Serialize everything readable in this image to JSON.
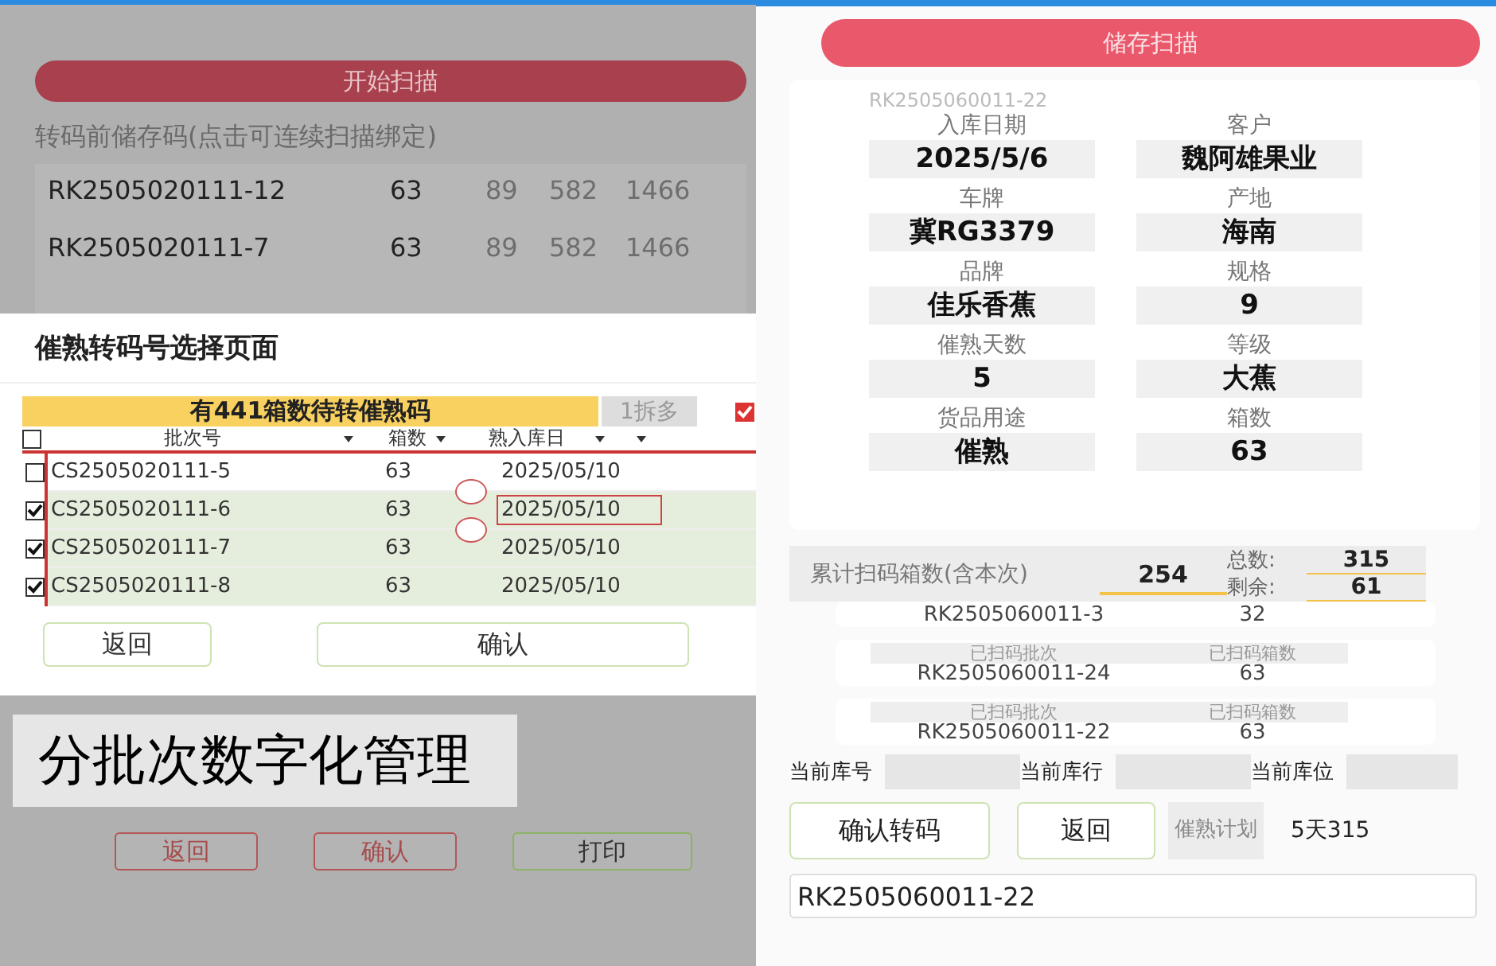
{
  "left_screen": {
    "background_page": {
      "scan_button": "开始扫描",
      "section_label": "转码前储存码(点击可连续扫描绑定)",
      "rows": [
        {
          "code": "RK2505020111-12",
          "boxes": "63",
          "column_3": "89",
          "column_4": "582",
          "column_5": "1466"
        },
        {
          "code": "RK2505020111-7",
          "boxes": "63",
          "column_3": "89",
          "column_4": "582",
          "column_5": "1466"
        }
      ],
      "buttons": [
        {
          "label": "返回",
          "kind": "danger"
        },
        {
          "label": "确认",
          "kind": "danger"
        },
        {
          "label": "打印",
          "kind": "ok"
        }
      ]
    },
    "dialog": {
      "title": "催熟转码号选择页面",
      "banner": "有441箱数待转催熟码",
      "split_button": "1拆多",
      "banner_checkbox": {
        "checked": true
      },
      "select_all": {
        "checked": false
      },
      "columns": [
        "批次号",
        "箱数",
        "熟入库日"
      ],
      "rows": [
        {
          "batch": "CS2505020111-5",
          "boxes": "63",
          "date": "2025/05/10",
          "checked": false,
          "selected": false,
          "editing": false
        },
        {
          "batch": "CS2505020111-6",
          "boxes": "63",
          "date": "2025/05/10",
          "checked": true,
          "selected": true,
          "editing": true
        },
        {
          "batch": "CS2505020111-7",
          "boxes": "63",
          "date": "2025/05/10",
          "checked": true,
          "selected": true,
          "editing": false
        },
        {
          "batch": "CS2505020111-8",
          "boxes": "63",
          "date": "2025/05/10",
          "checked": true,
          "selected": true,
          "editing": false
        }
      ],
      "buttons": [
        "返回",
        "确认"
      ]
    },
    "caption": "分批次数字化管理"
  },
  "right_screen": {
    "scan_button": "储存扫描",
    "code": "RK2505060011-22",
    "fields": [
      {
        "label": "入库日期",
        "value": "2025/5/6"
      },
      {
        "label": "客户",
        "value": "魏阿雄果业"
      },
      {
        "label": "车牌",
        "value": "冀RG3379"
      },
      {
        "label": "产地",
        "value": "海南"
      },
      {
        "label": "品牌",
        "value": "佳乐香蕉"
      },
      {
        "label": "规格",
        "value": "9"
      },
      {
        "label": "催熟天数",
        "value": "5"
      },
      {
        "label": "等级",
        "value": "大蕉"
      },
      {
        "label": "货品用途",
        "value": "催熟"
      },
      {
        "label": "箱数",
        "value": "63"
      }
    ],
    "summary": {
      "label": "累计扫码箱数(含本次)",
      "scanned": "254",
      "total_label": "总数:",
      "total": "315",
      "remaining_label": "剩余:",
      "remaining": "61"
    },
    "scanned_batches": [
      {
        "batch": "RK2505060011-3",
        "boxes": "32"
      },
      {
        "batch_label": "已扫码批次",
        "boxes_label": "已扫码箱数",
        "batch": "RK2505060011-24",
        "boxes": "63"
      },
      {
        "batch_label": "已扫码批次",
        "boxes_label": "已扫码箱数",
        "batch": "RK2505060011-22",
        "boxes": "63"
      }
    ],
    "location_labels": [
      "当前库号",
      "当前库行",
      "当前库位"
    ],
    "buttons": [
      "确认转码",
      "返回"
    ],
    "plan_label": "催熟计划",
    "plan_value": "5天315",
    "code_input": {
      "value": "RK2505060011-22"
    }
  }
}
